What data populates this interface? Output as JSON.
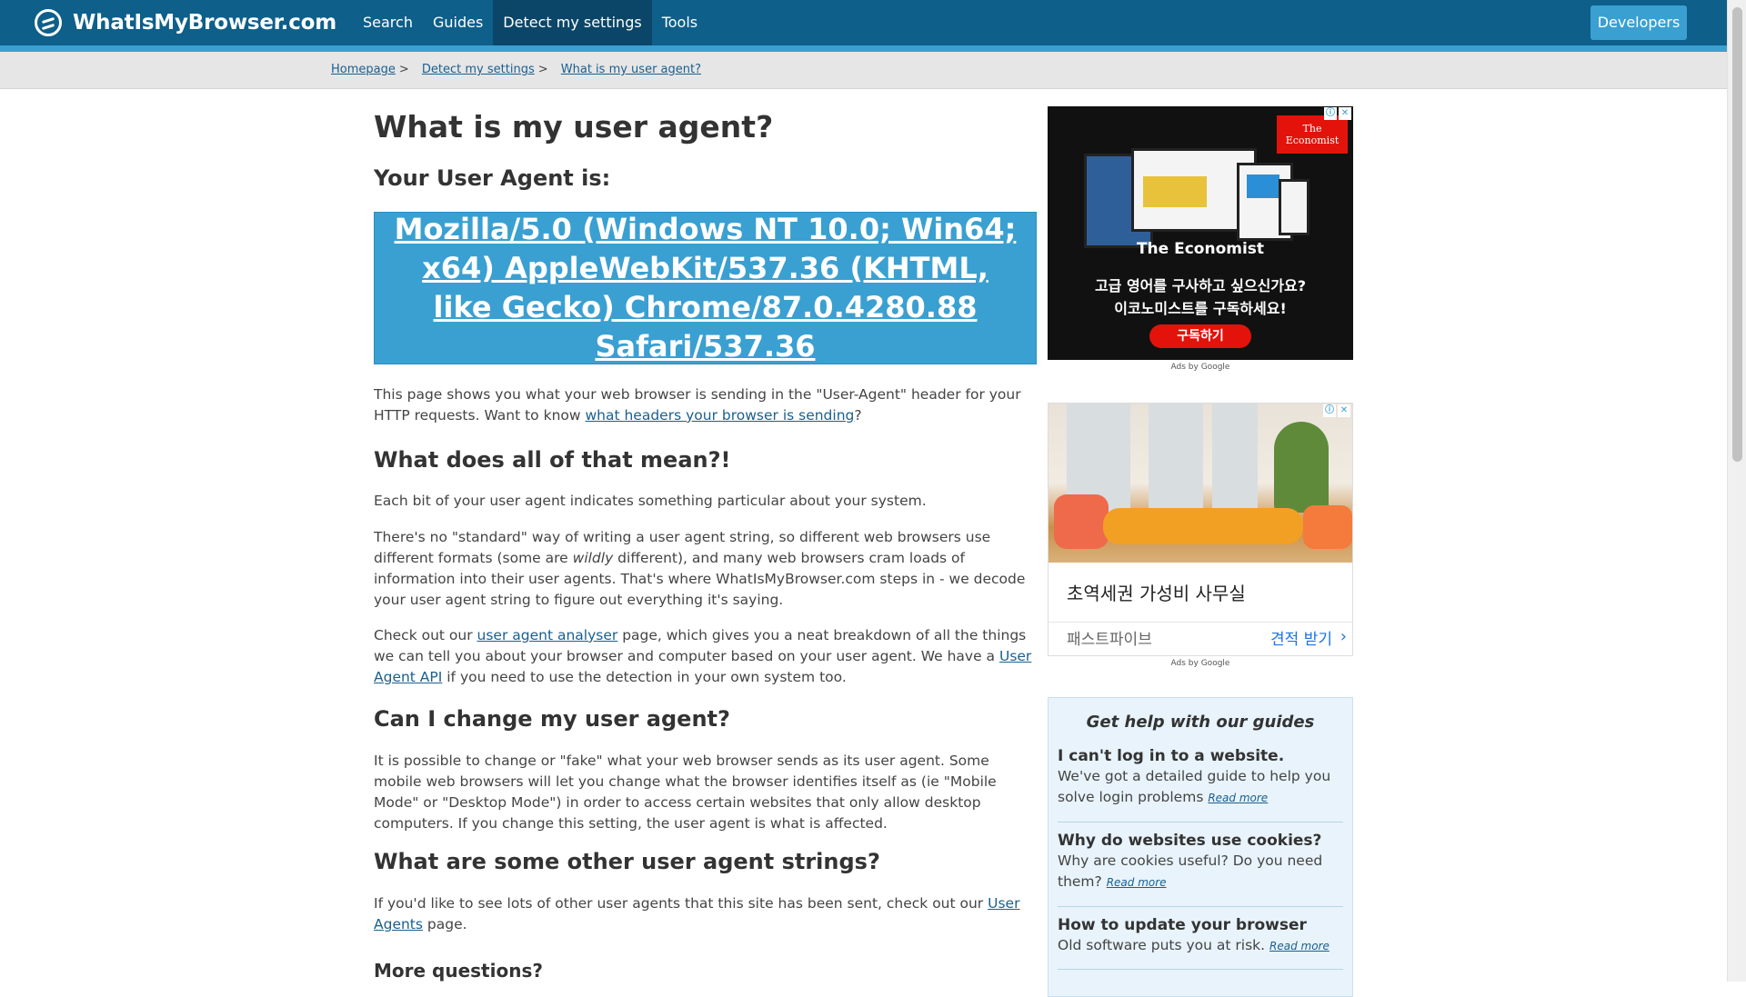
{
  "header": {
    "logo": "WhatIsMyBrowser.com",
    "nav": [
      "Search",
      "Guides",
      "Detect my settings",
      "Tools"
    ],
    "developers": "Developers"
  },
  "breadcrumb": [
    "Homepage",
    "Detect my settings",
    "What is my user agent?"
  ],
  "main": {
    "title": "What is my user agent?",
    "ua_heading": "Your User Agent is:",
    "user_agent": "Mozilla/5.0 (Windows NT 10.0; Win64; x64) AppleWebKit/537.36 (KHTML, like Gecko) Chrome/87.0.4280.88 Safari/537.36",
    "intro_text": "This page shows you what your web browser is sending in the \"User-Agent\" header for your HTTP requests. Want to know ",
    "intro_link": "what headers your browser is sending",
    "intro_end": "?",
    "mean_heading": "What does all of that mean?!",
    "mean_p1": "Each bit of your user agent indicates something particular about your system.",
    "mean_p2_a": "There's no \"standard\" way of writing a user agent string, so different web browsers use different formats (some are ",
    "mean_p2_em": "wildly",
    "mean_p2_b": " different), and many web browsers cram loads of information into their user agents. That's where WhatIsMyBrowser.com steps in - we decode your user agent string to figure out everything it's saying.",
    "mean_p3_a": "Check out our ",
    "mean_p3_link1": "user agent analyser",
    "mean_p3_b": " page, which gives you a neat breakdown of all the things we can tell you about your browser and computer based on your user agent. We have a ",
    "mean_p3_link2": "User Agent API",
    "mean_p3_c": " if you need to use the detection in your own system too.",
    "change_heading": "Can I change my user agent?",
    "change_p": "It is possible to change or \"fake\" what your web browser sends as its user agent. Some mobile web browsers will let you change what the browser identifies itself as (ie \"Mobile Mode\" or \"Desktop Mode\") in order to access certain websites that only allow desktop computers. If you change this setting, the user agent is what is affected.",
    "other_heading": "What are some other user agent strings?",
    "other_p_a": "If you'd like to see lots of other user agents that this site has been sent, check out our ",
    "other_p_link": "User Agents",
    "other_p_b": " page.",
    "more_heading": "More questions?"
  },
  "ad1": {
    "brand_logo": "The Economist",
    "title": "The Economist",
    "line1": "고급 영어를 구사하고 싶으신가요?",
    "line2": "이코노미스트를 구독하세요!",
    "button": "구독하기",
    "ads_by": "Ads by Google"
  },
  "ad2": {
    "title": "초역세권 가성비 사무실",
    "brand": "패스트파이브",
    "cta": "견적 받기",
    "ads_by": "Ads by Google"
  },
  "help": {
    "title": "Get help with our guides",
    "items": [
      {
        "heading": "I can't log in to a website.",
        "text": "We've got a detailed guide to help you solve login problems ",
        "link": "Read more"
      },
      {
        "heading": "Why do websites use cookies?",
        "text": "Why are cookies useful? Do you need them? ",
        "link": "Read more"
      },
      {
        "heading": "How to update your browser",
        "text": "Old software puts you at risk. ",
        "link": "Read more"
      }
    ]
  },
  "colors": {
    "header_bg": "#0e5f8a",
    "accent": "#3aa0d1",
    "link": "#1a5f8f"
  }
}
